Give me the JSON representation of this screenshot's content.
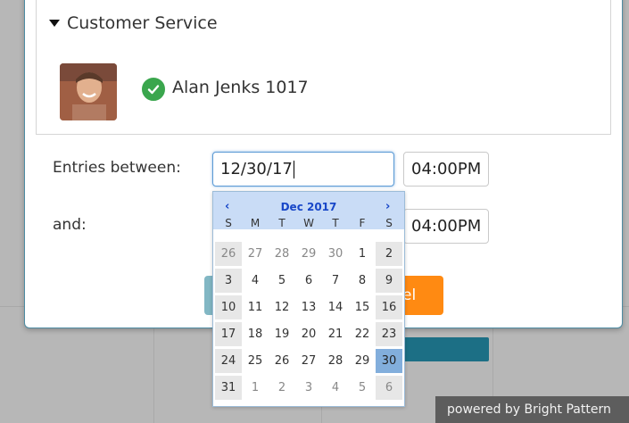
{
  "section": {
    "title": "Customer Service"
  },
  "user": {
    "name": "Alan Jenks 1017",
    "status": "online-check-icon"
  },
  "filter": {
    "entries_label": "Entries between:",
    "and_label": "and:",
    "start_date": "12/30/17",
    "start_time": "04:00PM",
    "end_time": "04:00PM"
  },
  "buttons": {
    "cancel_partial": "el"
  },
  "calendar": {
    "prev": "‹",
    "next": "›",
    "title": "Dec 2017",
    "weekdays": [
      "S",
      "M",
      "T",
      "W",
      "T",
      "F",
      "S"
    ],
    "weeks": [
      [
        "26",
        "27",
        "28",
        "29",
        "30",
        "1",
        "2"
      ],
      [
        "3",
        "4",
        "5",
        "6",
        "7",
        "8",
        "9"
      ],
      [
        "10",
        "11",
        "12",
        "13",
        "14",
        "15",
        "16"
      ],
      [
        "17",
        "18",
        "19",
        "20",
        "21",
        "22",
        "23"
      ],
      [
        "24",
        "25",
        "26",
        "27",
        "28",
        "29",
        "30"
      ],
      [
        "31",
        "1",
        "2",
        "3",
        "4",
        "5",
        "6"
      ]
    ],
    "selected": "30"
  },
  "footer": {
    "powered": "powered by Bright Pattern"
  },
  "colors": {
    "accent_orange": "#ff8a12",
    "selected_day": "#82aedc",
    "header_blue": "#c9dcf6",
    "brand_teal": "#1c6f85"
  }
}
